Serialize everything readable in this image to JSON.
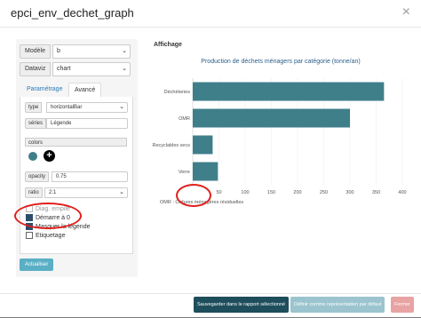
{
  "dialog": {
    "title": "epci_env_dechet_graph",
    "close_glyph": "×"
  },
  "form": {
    "modele": {
      "label": "Modèle",
      "value": "b"
    },
    "dataviz": {
      "label": "Dataviz",
      "value": "chart"
    },
    "tabs": [
      {
        "label": "Paramétrage"
      },
      {
        "label": "Avancé"
      }
    ],
    "type": {
      "label": "type",
      "value": "horizontalBar"
    },
    "series": {
      "label": "séries",
      "value": "Légende"
    },
    "colors": {
      "label": "colors",
      "swatch": "#3f7f8a"
    },
    "opacity": {
      "label": "opacity",
      "value": "0.75"
    },
    "ratio": {
      "label": "ratio",
      "value": "2:1"
    },
    "checkboxes": [
      {
        "label": "Diag. empilé",
        "checked": false
      },
      {
        "label": "Démarre à 0",
        "checked": true
      },
      {
        "label": "Masquer la légende",
        "checked": true
      },
      {
        "label": "Etiquetage",
        "checked": false
      }
    ],
    "apply_label": "Actualiser"
  },
  "preview": {
    "section_title": "Affichage"
  },
  "chart_data": {
    "type": "bar",
    "orientation": "horizontal",
    "title": "Production de déchets ménagers par catégorie (tonne/an)",
    "categories": [
      "Déchèteries",
      "OMR",
      "Recyclables secs",
      "Verre"
    ],
    "values": [
      365,
      300,
      38,
      48
    ],
    "xlim": [
      0,
      400
    ],
    "xticks": [
      "50",
      "100",
      "150",
      "200",
      "250",
      "300",
      "350",
      "400"
    ],
    "color": "#3f7f8a",
    "footnote": "OMR : Ordures ménagères résiduelles"
  },
  "footer": {
    "save_label": "Sauvegarder dans le rapport sélectionné",
    "default_label": "Définir comme représentation par défaut",
    "close_label": "Fermer"
  }
}
